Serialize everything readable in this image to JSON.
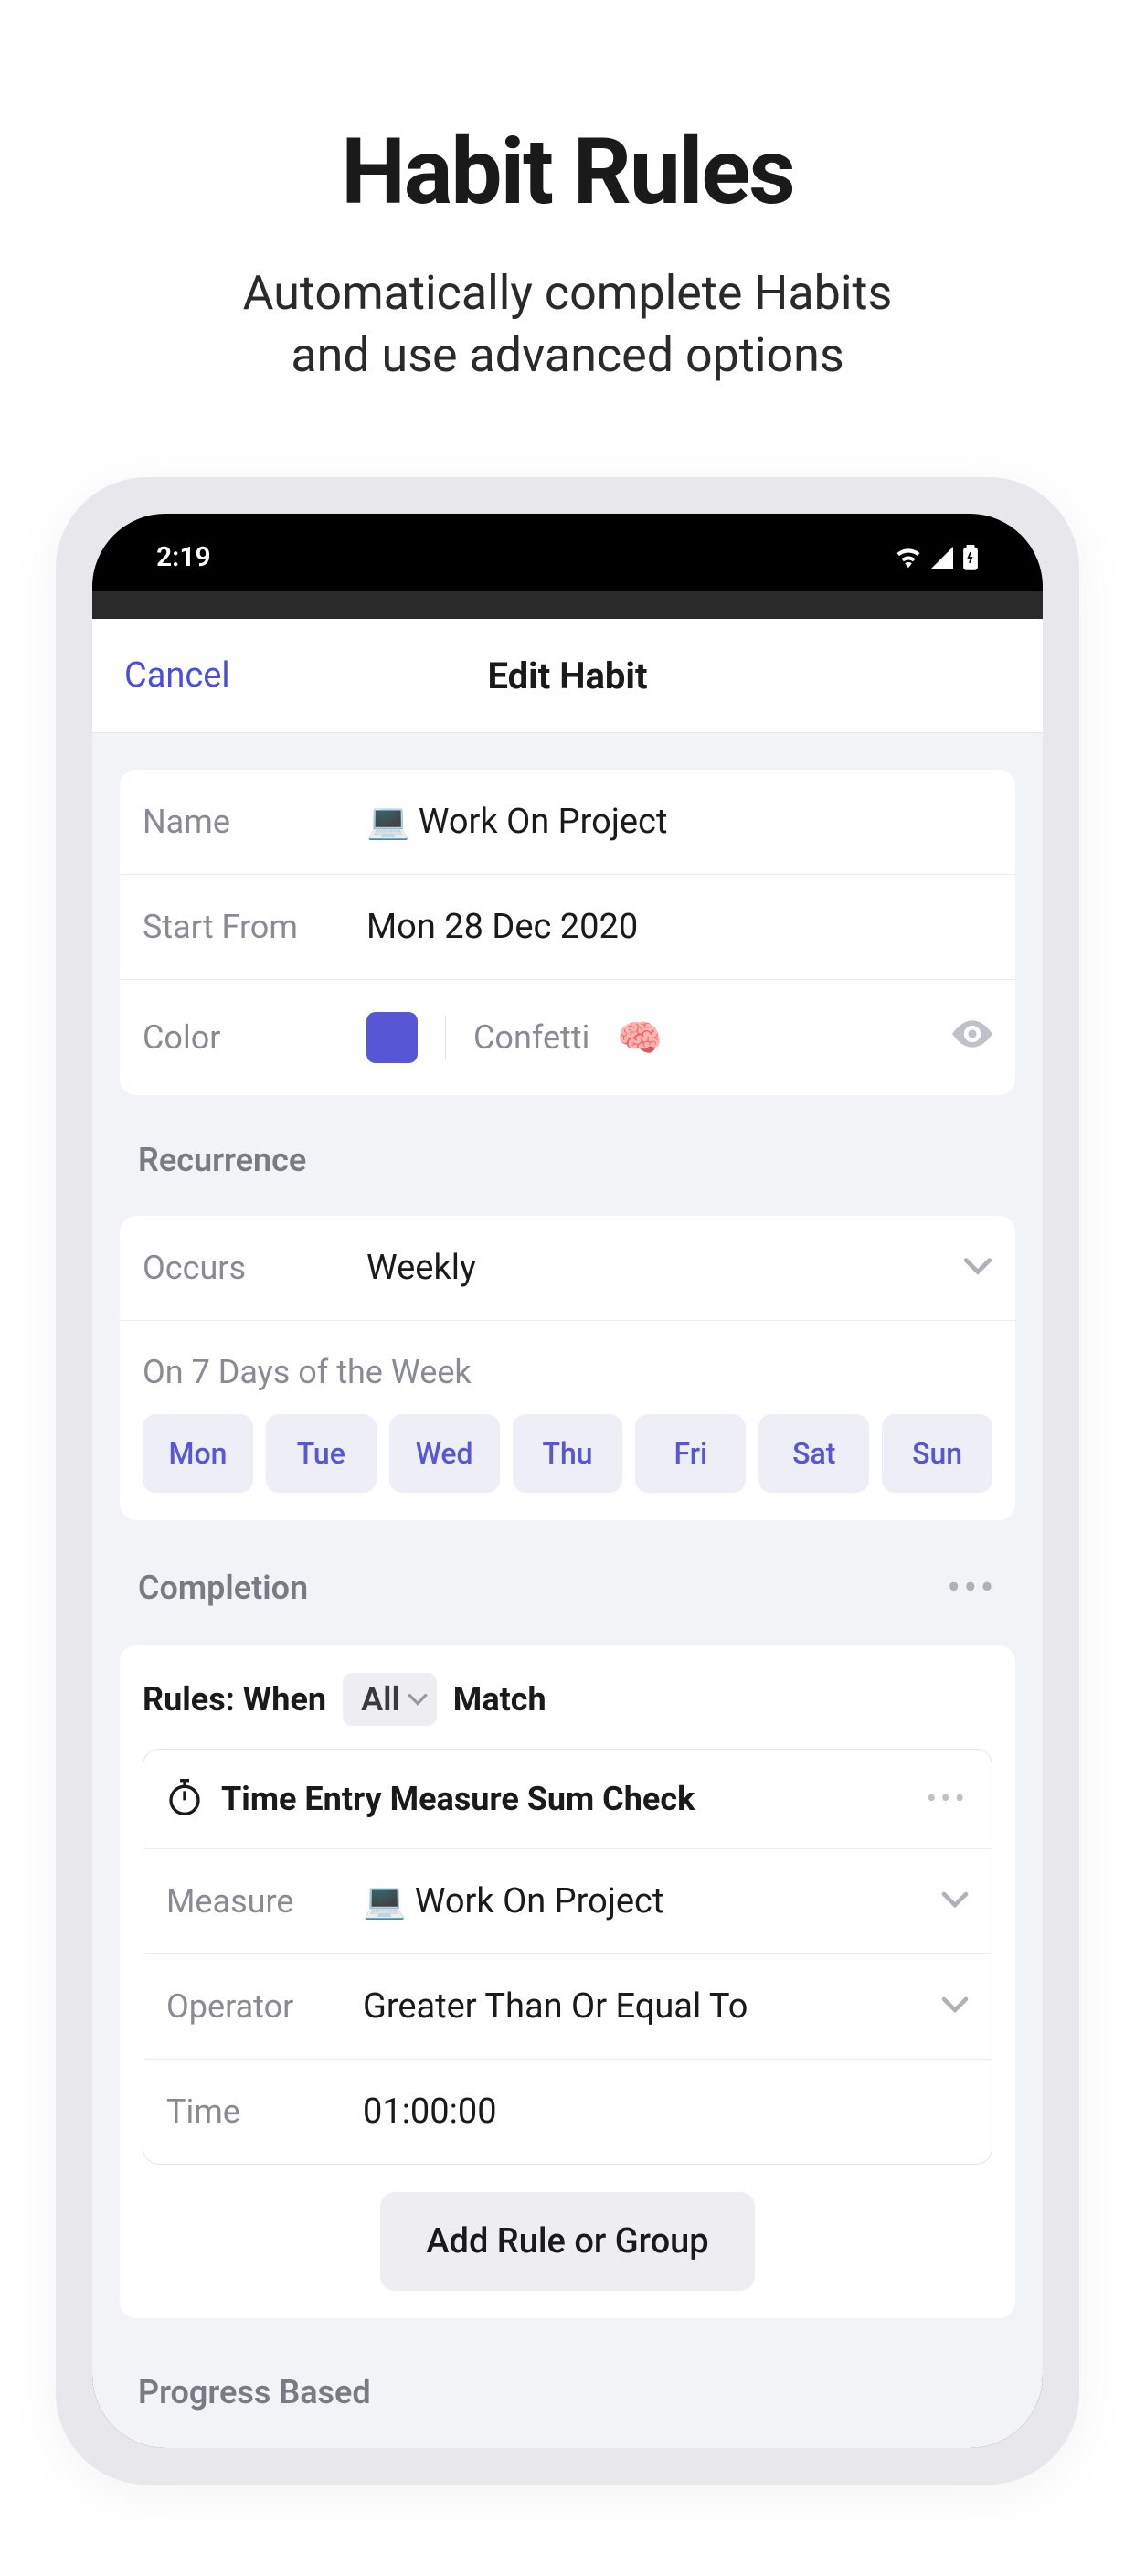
{
  "marketing": {
    "title": "Habit Rules",
    "subtitle_line1": "Automatically complete Habits",
    "subtitle_line2": "and use advanced options"
  },
  "status": {
    "time": "2:19"
  },
  "header": {
    "cancel": "Cancel",
    "title": "Edit Habit"
  },
  "basic": {
    "name_label": "Name",
    "name_value": "💻 Work On Project",
    "start_label": "Start From",
    "start_value": "Mon 28 Dec 2020",
    "color_label": "Color",
    "color_hex": "#5756d5",
    "confetti_label": "Confetti",
    "confetti_emoji": "🧠"
  },
  "recurrence": {
    "header": "Recurrence",
    "occurs_label": "Occurs",
    "occurs_value": "Weekly",
    "days_label": "On 7 Days of the Week",
    "days": [
      "Mon",
      "Tue",
      "Wed",
      "Thu",
      "Fri",
      "Sat",
      "Sun"
    ]
  },
  "completion": {
    "header": "Completion",
    "rules_prefix": "Rules: When",
    "match_mode": "All",
    "match_suffix": "Match",
    "rule": {
      "title": "Time Entry Measure Sum Check",
      "measure_label": "Measure",
      "measure_value": "💻 Work On Project",
      "operator_label": "Operator",
      "operator_value": "Greater Than Or Equal To",
      "time_label": "Time",
      "time_value": "01:00:00"
    },
    "add_button": "Add Rule or Group"
  },
  "progress": {
    "header": "Progress Based"
  }
}
